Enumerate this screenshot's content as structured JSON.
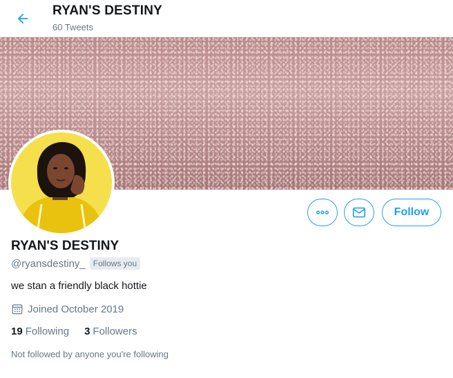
{
  "header": {
    "title": "RYAN'S DESTINY",
    "subtitle": "60 Tweets",
    "back_icon": "arrow-left-icon"
  },
  "profile": {
    "display_name": "RYAN'S DESTINY",
    "handle": "@ryansdestiny_",
    "follows_you": "Follows you",
    "bio": "we stan a friendly black hottie",
    "joined": "Joined October 2019",
    "following_count": "19",
    "following_label": "Following",
    "followers_count": "3",
    "followers_label": "Followers",
    "not_followed_text": "Not followed by anyone you're following"
  },
  "actions": {
    "more_icon": "more-icon",
    "message_icon": "envelope-icon",
    "follow_label": "Follow"
  },
  "colors": {
    "accent": "#1da1f2",
    "muted": "#657786",
    "text": "#14171a",
    "banner": "#c9a1a1",
    "avatar_bg": "#f5df4d"
  }
}
